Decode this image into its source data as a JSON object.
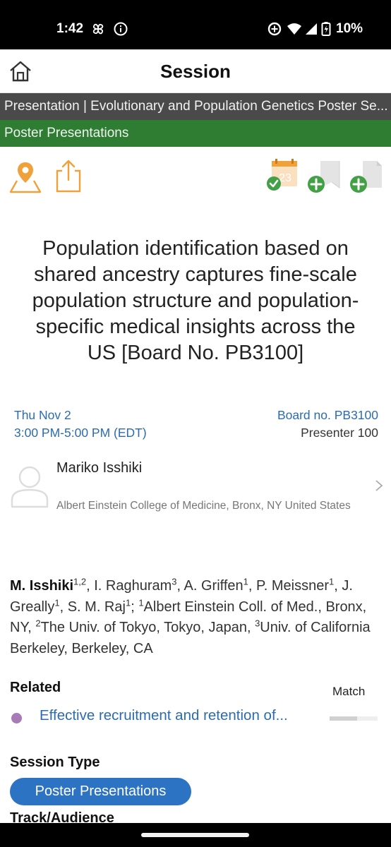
{
  "status_bar": {
    "time": "1:42",
    "battery": "10%"
  },
  "header": {
    "title": "Session"
  },
  "breadcrumb": "Presentation | Evolutionary and Population Genetics Poster Se...",
  "category": "Poster Presentations",
  "calendar": {
    "day": "23"
  },
  "presentation": {
    "title": "Population identification based on shared ancestry captures fine-scale population structure and population-specific medical insights across the US [Board No. PB3100]",
    "date": "Thu Nov 2",
    "time": "3:00 PM-5:00 PM (EDT)",
    "board": "Board no. PB3100",
    "presenter_no": "Presenter 100"
  },
  "presenter": {
    "name": "Mariko Isshiki",
    "affiliation": "Albert Einstein College of Medicine, Bronx, NY United States"
  },
  "authors": {
    "a1": "M. Isshiki",
    "a1_sup": "1,2",
    "a2": ", I. Raghuram",
    "a2_sup": "3",
    "a3": ", A. Griffen",
    "a3_sup": "1",
    "a4": ", P. Meissner",
    "a4_sup": "1",
    "a5": ", J. Greally",
    "a5_sup": "1",
    "a6": ", S. M. Raj",
    "a6_sup": "1",
    "sep": "; ",
    "inst1_sup": "1",
    "inst1": "Albert Einstein Coll. of Med., Bronx, NY, ",
    "inst2_sup": "2",
    "inst2": "The Univ. of Tokyo, Tokyo, Japan, ",
    "inst3_sup": "3",
    "inst3": "Univ. of California Berkeley, Berkeley, CA"
  },
  "related": {
    "heading": "Related",
    "match_label": "Match",
    "items": [
      {
        "title": "Effective recruitment and retention of...",
        "match": 0.58,
        "dot_color": "#a77bb5"
      }
    ]
  },
  "session_type": {
    "heading": "Session Type",
    "value": "Poster Presentations"
  },
  "track": {
    "heading": "Track/Audience"
  },
  "colors": {
    "accent_blue": "#2b6cb0",
    "category_green": "#2e7d32",
    "icon_orange": "#f0a13a",
    "check_green": "#43a047"
  }
}
